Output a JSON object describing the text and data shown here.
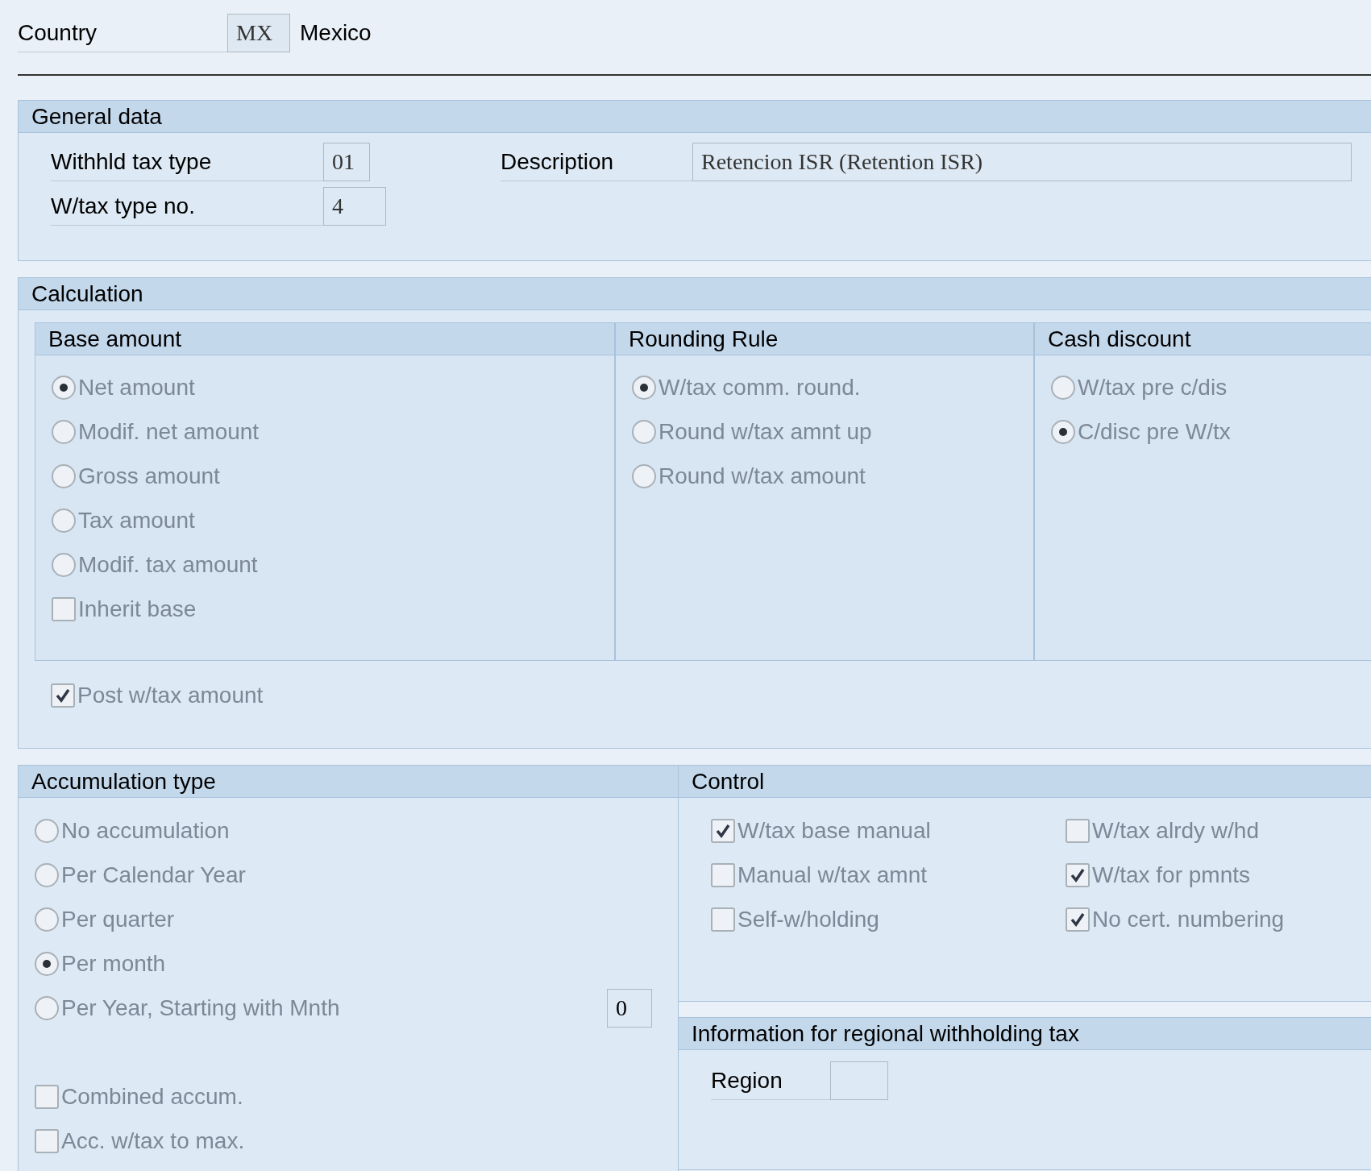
{
  "country": {
    "label": "Country",
    "value": "MX",
    "name": "Mexico"
  },
  "general_data": {
    "title": "General data",
    "fields": [
      {
        "label": "Withhld tax type",
        "value": "01"
      },
      {
        "label": "W/tax type no.",
        "value": "4"
      }
    ],
    "description": {
      "label": "Description",
      "value": "Retencion ISR (Retention ISR)"
    }
  },
  "calculation": {
    "title": "Calculation",
    "groups": [
      {
        "title": "Base amount",
        "items": [
          {
            "kind": "radio",
            "label": "Net amount",
            "selected": true,
            "disabled": true
          },
          {
            "kind": "radio",
            "label": "Modif. net amount",
            "selected": false,
            "disabled": true
          },
          {
            "kind": "radio",
            "label": "Gross amount",
            "selected": false,
            "disabled": true
          },
          {
            "kind": "radio",
            "label": "Tax amount",
            "selected": false,
            "disabled": true
          },
          {
            "kind": "radio",
            "label": "Modif. tax amount",
            "selected": false,
            "disabled": true
          },
          {
            "kind": "checkbox",
            "label": "Inherit base",
            "checked": false,
            "disabled": true
          }
        ]
      },
      {
        "title": "Rounding Rule",
        "items": [
          {
            "kind": "radio",
            "label": "W/tax comm. round.",
            "selected": true,
            "disabled": true
          },
          {
            "kind": "radio",
            "label": "Round w/tax amnt up",
            "selected": false,
            "disabled": true
          },
          {
            "kind": "radio",
            "label": "Round w/tax amount",
            "selected": false,
            "disabled": true
          }
        ]
      },
      {
        "title": "Cash discount",
        "items": [
          {
            "kind": "radio",
            "label": "W/tax pre c/dis",
            "selected": false,
            "disabled": true
          },
          {
            "kind": "radio",
            "label": "C/disc pre W/tx",
            "selected": true,
            "disabled": true
          }
        ]
      }
    ],
    "post": {
      "kind": "checkbox",
      "label": "Post w/tax amount",
      "checked": true,
      "disabled": true
    }
  },
  "accumulation": {
    "title": "Accumulation type",
    "items": [
      {
        "kind": "radio",
        "label": "No accumulation",
        "selected": false,
        "disabled": true
      },
      {
        "kind": "radio",
        "label": "Per Calendar Year",
        "selected": false,
        "disabled": true
      },
      {
        "kind": "radio",
        "label": "Per quarter",
        "selected": false,
        "disabled": true
      },
      {
        "kind": "radio",
        "label": "Per month",
        "selected": true,
        "disabled": true
      },
      {
        "kind": "radio",
        "label": "Per Year, Starting with Mnth",
        "selected": false,
        "disabled": true,
        "value": "0"
      }
    ],
    "checkboxes": [
      {
        "kind": "checkbox",
        "label": "Combined accum.",
        "checked": false,
        "disabled": true
      },
      {
        "kind": "checkbox",
        "label": "Acc. w/tax to max.",
        "checked": false,
        "disabled": true
      }
    ]
  },
  "control": {
    "title": "Control",
    "items": [
      {
        "kind": "checkbox",
        "label": "W/tax base manual",
        "checked": true,
        "disabled": true
      },
      {
        "kind": "checkbox",
        "label": "W/tax alrdy w/hd",
        "checked": false,
        "disabled": true
      },
      {
        "kind": "checkbox",
        "label": "Manual w/tax amnt",
        "checked": false,
        "disabled": true
      },
      {
        "kind": "checkbox",
        "label": "W/tax for pmnts",
        "checked": true,
        "disabled": true
      },
      {
        "kind": "checkbox",
        "label": "Self-w/holding",
        "checked": false,
        "disabled": true
      },
      {
        "kind": "checkbox",
        "label": "No cert. numbering",
        "checked": true,
        "disabled": true
      }
    ]
  },
  "regional": {
    "title": "Information for regional withholding tax",
    "region": {
      "label": "Region"
    }
  }
}
